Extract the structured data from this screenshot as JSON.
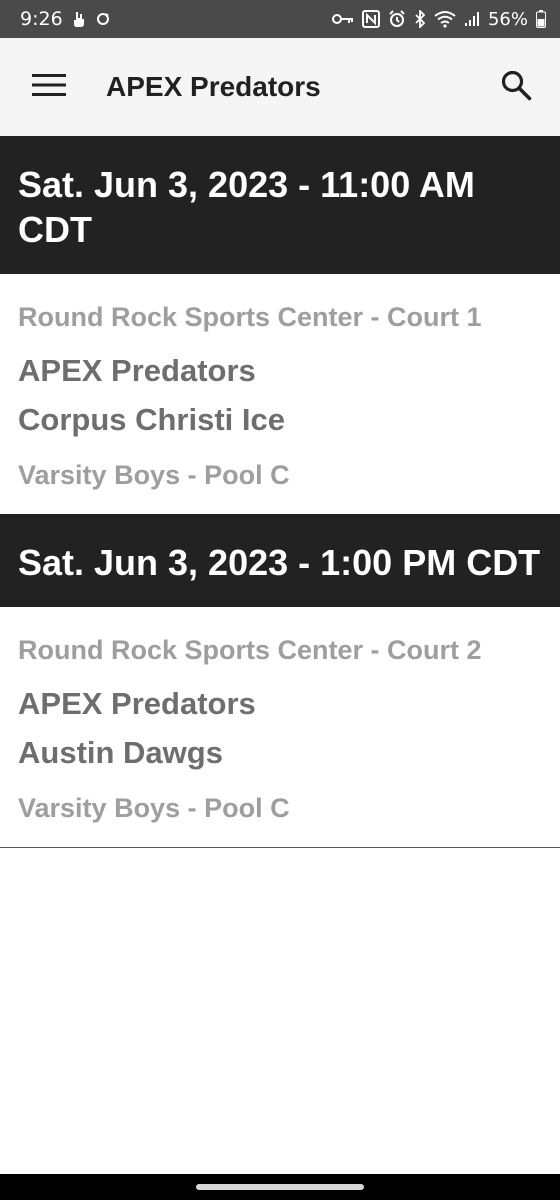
{
  "status_bar": {
    "time": "9:26",
    "battery": "56%",
    "left_icons": [
      "hand-notification-icon",
      "sync-icon"
    ],
    "right_icons": [
      "key-icon",
      "nfc-icon",
      "alarm-icon",
      "bluetooth-icon",
      "wifi-icon",
      "signal-icon",
      "battery-icon"
    ]
  },
  "app_bar": {
    "title": "APEX Predators",
    "menu_icon": "menu-icon",
    "search_icon": "search-icon"
  },
  "games": [
    {
      "date_time": "Sat. Jun 3, 2023 - 11:00 AM CDT",
      "venue": "Round Rock Sports Center - Court 1",
      "team_1": "APEX Predators",
      "team_2": "Corpus Christi Ice",
      "division": "Varsity Boys - Pool C"
    },
    {
      "date_time": "Sat. Jun 3, 2023 - 1:00 PM CDT",
      "venue": "Round Rock Sports Center - Court 2",
      "team_1": "APEX Predators",
      "team_2": "Austin Dawgs",
      "division": "Varsity Boys - Pool C"
    }
  ],
  "colors": {
    "status_bar": "#4a4a4a",
    "app_bar": "#f5f5f5",
    "date_header": "#222222",
    "team_text": "#6e6e6e",
    "meta_text": "#9e9e9e"
  }
}
